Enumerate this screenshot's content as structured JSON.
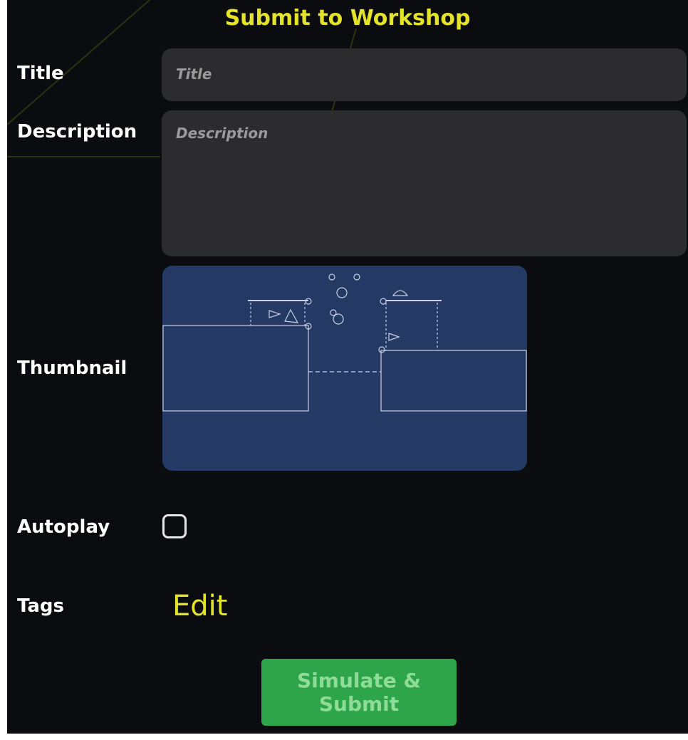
{
  "header": {
    "title": "Submit to Workshop"
  },
  "form": {
    "title_label": "Title",
    "title_placeholder": "Title",
    "description_label": "Description",
    "description_placeholder": "Description",
    "thumbnail_label": "Thumbnail",
    "autoplay_label": "Autoplay",
    "autoplay_checked": false,
    "tags_label": "Tags",
    "tags_edit_label": "Edit",
    "submit_label": "Simulate & Submit"
  },
  "colors": {
    "background": "#0b0c10",
    "accent_yellow": "#e3e32a",
    "field_bg": "#2c2c2e",
    "thumbnail_bg": "#243963",
    "submit_green": "#2ea54a"
  },
  "icons": {
    "thumbnail": "level-preview-image",
    "checkbox": "checkbox-empty-icon"
  }
}
